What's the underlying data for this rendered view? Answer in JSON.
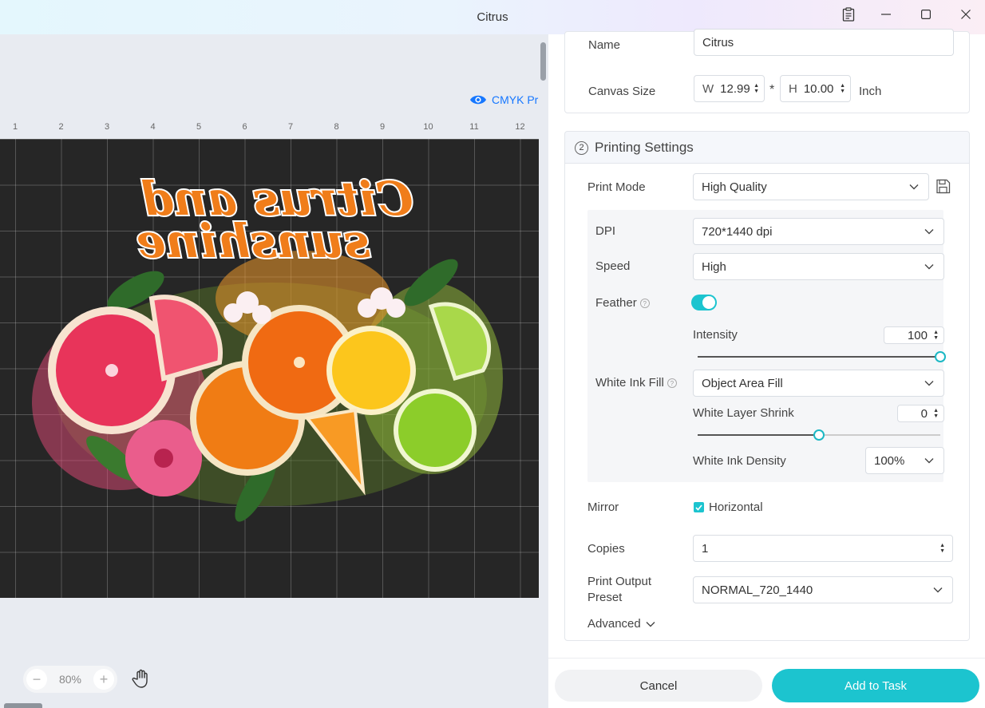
{
  "window": {
    "title": "Citrus",
    "controls": [
      "clipboard-icon",
      "minimize-icon",
      "maximize-icon",
      "close-icon"
    ]
  },
  "canvas": {
    "cmyk_label": "CMYK Prev",
    "ruler_ticks": [
      "1",
      "2",
      "3",
      "4",
      "5",
      "6",
      "7",
      "8",
      "9",
      "10",
      "11",
      "12"
    ],
    "artwork_text_line1": "Citrus and",
    "artwork_text_line2": "sunshine",
    "zoom": {
      "minus": "−",
      "value": "80%",
      "plus": "+"
    }
  },
  "panel": {
    "name": {
      "label": "Name",
      "value": "Citrus"
    },
    "canvas_size": {
      "label": "Canvas Size",
      "w_prefix": "W",
      "w_value": "12.99",
      "separator": "*",
      "h_prefix": "H",
      "h_value": "10.00",
      "unit": "Inch"
    },
    "printing": {
      "number": "2",
      "title": "Printing Settings",
      "print_mode": {
        "label": "Print Mode",
        "value": "High Quality"
      },
      "dpi": {
        "label": "DPI",
        "value": "720*1440 dpi"
      },
      "speed": {
        "label": "Speed",
        "value": "High"
      },
      "feather": {
        "label": "Feather",
        "enabled": true
      },
      "intensity": {
        "label": "Intensity",
        "value": "100",
        "level": 1.0
      },
      "white_ink_fill": {
        "label": "White Ink Fill",
        "value": "Object Area Fill"
      },
      "white_layer_shrink": {
        "label": "White Layer Shrink",
        "value": "0",
        "level": 0.5
      },
      "white_ink_density": {
        "label": "White Ink Density",
        "value": "100%"
      },
      "mirror": {
        "label": "Mirror",
        "option": "Horizontal",
        "checked": true
      },
      "copies": {
        "label": "Copies",
        "value": "1"
      },
      "output_preset": {
        "label_line1": "Print Output",
        "label_line2": "Preset",
        "value": "NORMAL_720_1440"
      },
      "advanced": "Advanced"
    },
    "footer": {
      "cancel": "Cancel",
      "add": "Add to Task"
    }
  },
  "colors": {
    "accent": "#1cc4cf",
    "link": "#1677ff",
    "artboard": "#262626"
  }
}
